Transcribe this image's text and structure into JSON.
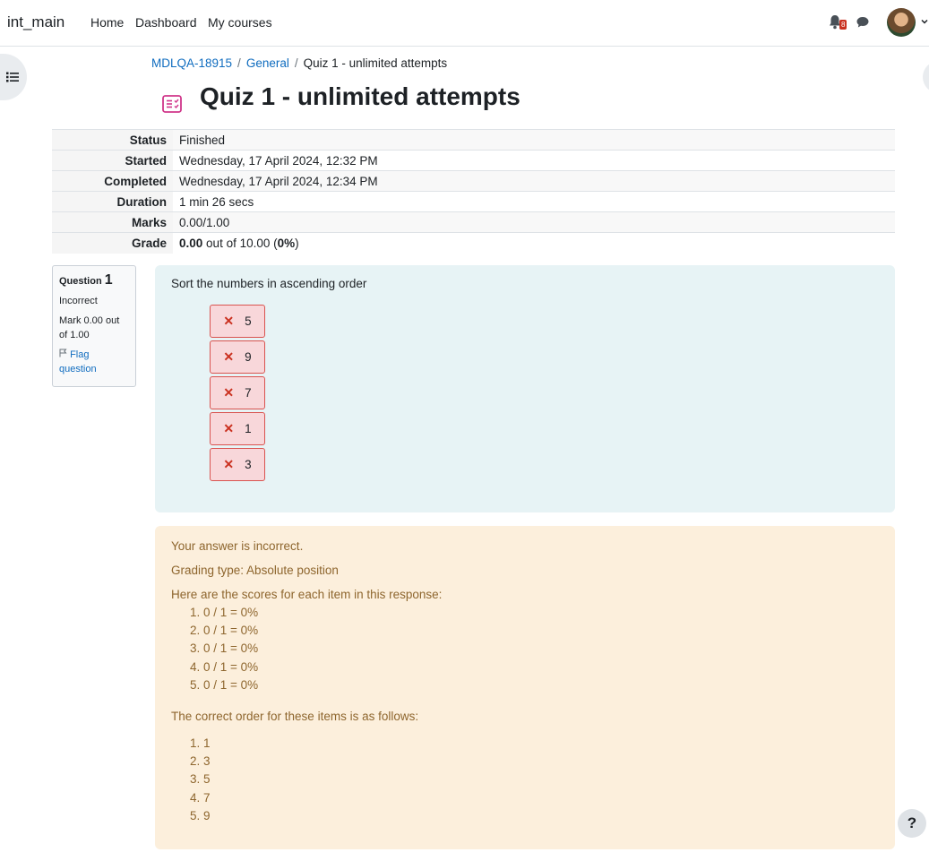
{
  "navbar": {
    "brand": "int_main",
    "links": [
      "Home",
      "Dashboard",
      "My courses"
    ],
    "notification_count": "8"
  },
  "breadcrumb": {
    "items": [
      "MDLQA-18915",
      "General"
    ],
    "current": "Quiz 1 - unlimited attempts",
    "separator": "/"
  },
  "page_title": "Quiz 1 - unlimited attempts",
  "summary": [
    {
      "label": "Status",
      "value": "Finished"
    },
    {
      "label": "Started",
      "value": "Wednesday, 17 April 2024, 12:32 PM"
    },
    {
      "label": "Completed",
      "value": "Wednesday, 17 April 2024, 12:34 PM"
    },
    {
      "label": "Duration",
      "value": "1 min 26 secs"
    },
    {
      "label": "Marks",
      "value": "0.00/1.00"
    }
  ],
  "grade": {
    "label": "Grade",
    "score": "0.00",
    "out_of": "out of 10.00 (",
    "percent": "0%",
    "close": ")"
  },
  "question_info": {
    "label": "Question",
    "number": "1",
    "state": "Incorrect",
    "mark": "Mark 0.00 out of 1.00",
    "flag": "Flag question"
  },
  "question": {
    "text": "Sort the numbers in ascending order",
    "items": [
      "5",
      "9",
      "7",
      "1",
      "3"
    ]
  },
  "feedback": {
    "incorrect": "Your answer is incorrect.",
    "grading_type": "Grading type: Absolute position",
    "scores_intro": "Here are the scores for each item in this response:",
    "scores": [
      "0 / 1 = 0%",
      "0 / 1 = 0%",
      "0 / 1 = 0%",
      "0 / 1 = 0%",
      "0 / 1 = 0%"
    ],
    "correct_intro": "The correct order for these items is as follows:",
    "correct_order": [
      "1",
      "3",
      "5",
      "7",
      "9"
    ]
  },
  "help": "?",
  "colors": {
    "link": "#0f6cbf",
    "incorrect_bg": "#f8d7da",
    "incorrect_border": "#d9534f",
    "question_bg": "#e7f3f5",
    "feedback_bg": "#fcefdc",
    "feedback_text": "#8e662e",
    "quiz_icon": "#d0368a"
  }
}
